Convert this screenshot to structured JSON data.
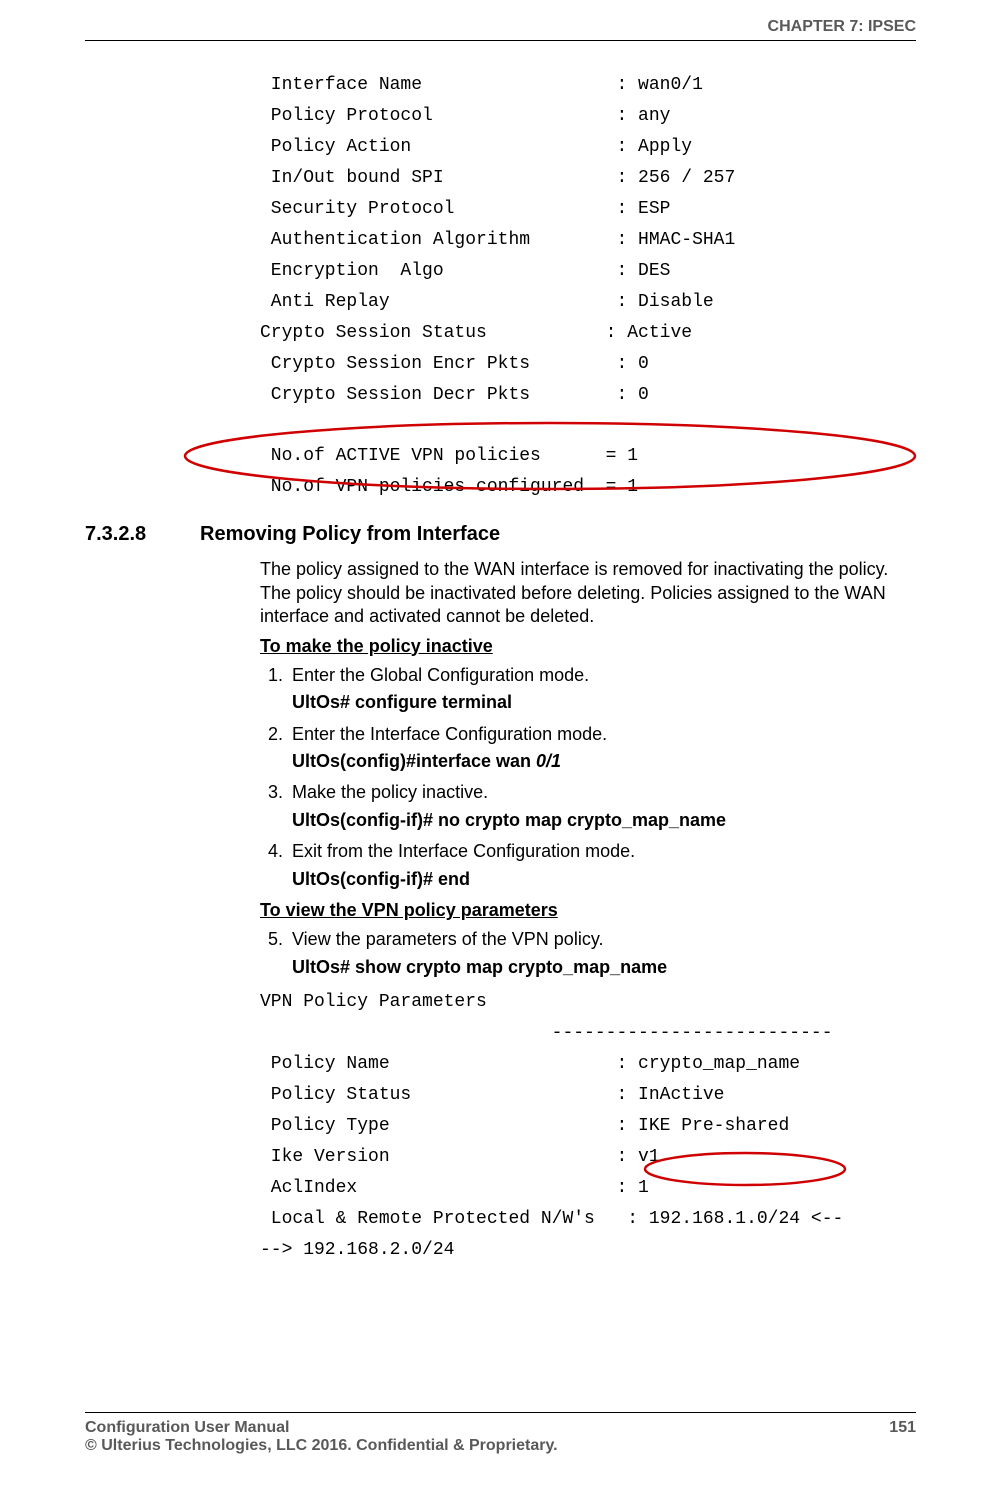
{
  "header": {
    "chapter": "CHAPTER 7: IPSEC"
  },
  "top_mono": " Interface Name                  : wan0/1\n Policy Protocol                 : any\n Policy Action                   : Apply\n In/Out bound SPI                : 256 / 257\n Security Protocol               : ESP\n Authentication Algorithm        : HMAC-SHA1\n Encryption  Algo                : DES\n Anti Replay                     : Disable\nCrypto Session Status           : Active\n Crypto Session Encr Pkts        : 0\n Crypto Session Decr Pkts        : 0\n\n No.of ACTIVE VPN policies      = 1\n No.of VPN policies configured  = 1",
  "section": {
    "num": "7.3.2.8",
    "title": "Removing Policy from Interface"
  },
  "intro": "The policy assigned to the WAN interface is removed for inactivating the policy. The policy should be inactivated before deleting. Policies assigned to the WAN interface and activated cannot be deleted.",
  "sub1": "To make the policy inactive",
  "steps": {
    "s1": "Enter the Global Configuration mode.",
    "c1": "UltOs# configure terminal",
    "s2": "Enter the Interface Configuration mode.",
    "c2a": "UltOs(config)#interface wan ",
    "c2b": "0/1",
    "s3": "Make the policy inactive.",
    "c3": "UltOs(config-if)# no crypto map crypto_map_name",
    "s4": "Exit from the Interface Configuration mode.",
    "c4": "UltOs(config-if)# end"
  },
  "sub2": "To view the VPN policy parameters",
  "steps2": {
    "s5": "View the parameters of the VPN policy.",
    "c5": "UltOs# show crypto map crypto_map_name"
  },
  "bottom_mono": "VPN Policy Parameters\n                           --------------------------\n Policy Name                     : crypto_map_name\n Policy Status                   : InActive\n Policy Type                     : IKE Pre-shared\n Ike Version                     : v1\n AclIndex                        : 1\n Local & Remote Protected N/W's   : 192.168.1.0/24 <--\n--> 192.168.2.0/24",
  "footer": {
    "left": "Configuration User Manual",
    "page": "151",
    "copyright": "© Ulterius Technologies, LLC 2016. Confidential & Proprietary."
  }
}
